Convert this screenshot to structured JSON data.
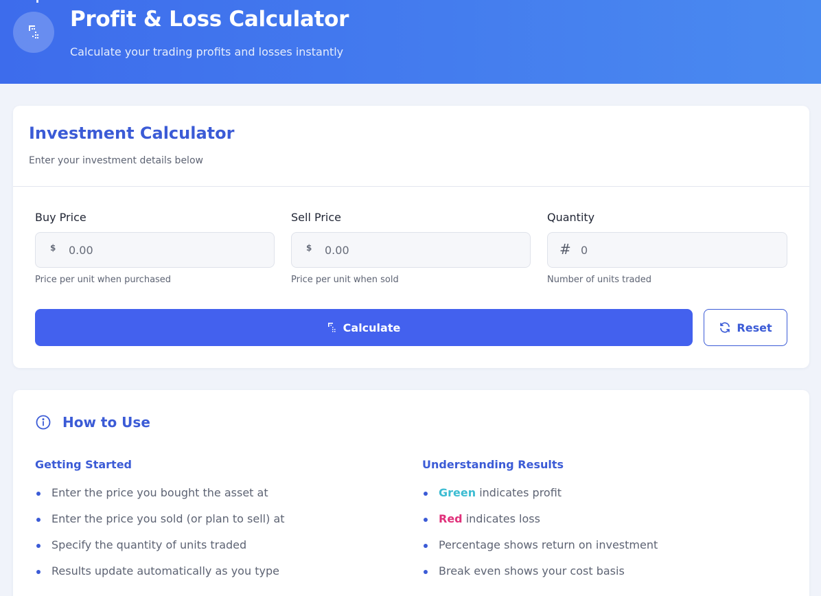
{
  "header": {
    "title": "Profit & Loss Calculator",
    "subtitle": "Calculate your trading profits and losses instantly",
    "logo_icon": "calculator-icon"
  },
  "calculator": {
    "title": "Investment Calculator",
    "subtitle": "Enter your investment details below",
    "fields": [
      {
        "label": "Buy Price",
        "prefix": "$",
        "placeholder": "0.00",
        "hint": "Price per unit when purchased"
      },
      {
        "label": "Sell Price",
        "prefix": "$",
        "placeholder": "0.00",
        "hint": "Price per unit when sold"
      },
      {
        "label": "Quantity",
        "prefix": "#",
        "placeholder": "0",
        "hint": "Number of units traded"
      }
    ],
    "calculate_label": "Calculate",
    "reset_label": "Reset"
  },
  "howto": {
    "title": "How to Use",
    "getting_started": {
      "title": "Getting Started",
      "items": [
        "Enter the price you bought the asset at",
        "Enter the price you sold (or plan to sell) at",
        "Specify the quantity of units traded",
        "Results update automatically as you type"
      ]
    },
    "understanding": {
      "title": "Understanding Results",
      "green_word": "Green",
      "green_text": " indicates profit",
      "red_word": "Red",
      "red_text": " indicates loss",
      "items": [
        "Percentage shows return on investment",
        "Break even shows your cost basis"
      ]
    }
  },
  "colors": {
    "accent": "#4361ee",
    "heading": "#3b5bd6",
    "profit": "#3cbcd2",
    "loss": "#e0307a"
  }
}
